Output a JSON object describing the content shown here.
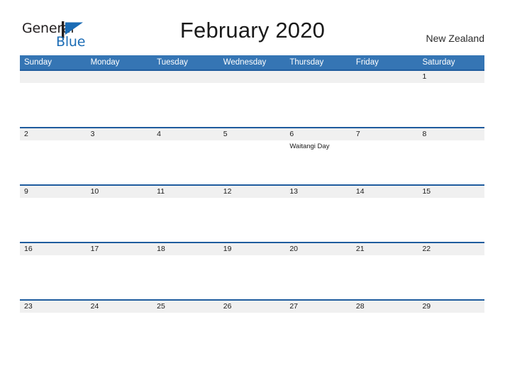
{
  "brand": {
    "word_one": "General",
    "word_two": "Blue",
    "mark": "triangle-flag-icon",
    "accent_color": "#1b6cb5"
  },
  "header": {
    "title": "February 2020",
    "region": "New Zealand"
  },
  "colors": {
    "header_blue": "#3575b4",
    "divider_blue": "#1f5c9e",
    "date_band_gray": "#f0f0f0",
    "text": "#1a1a1a"
  },
  "calendar": {
    "month": "February",
    "year": "2020",
    "weekday_headers": [
      "Sunday",
      "Monday",
      "Tuesday",
      "Wednesday",
      "Thursday",
      "Friday",
      "Saturday"
    ],
    "weeks": [
      {
        "days": [
          {
            "date": "",
            "event": ""
          },
          {
            "date": "",
            "event": ""
          },
          {
            "date": "",
            "event": ""
          },
          {
            "date": "",
            "event": ""
          },
          {
            "date": "",
            "event": ""
          },
          {
            "date": "",
            "event": ""
          },
          {
            "date": "1",
            "event": ""
          }
        ]
      },
      {
        "days": [
          {
            "date": "2",
            "event": ""
          },
          {
            "date": "3",
            "event": ""
          },
          {
            "date": "4",
            "event": ""
          },
          {
            "date": "5",
            "event": ""
          },
          {
            "date": "6",
            "event": "Waitangi Day"
          },
          {
            "date": "7",
            "event": ""
          },
          {
            "date": "8",
            "event": ""
          }
        ]
      },
      {
        "days": [
          {
            "date": "9",
            "event": ""
          },
          {
            "date": "10",
            "event": ""
          },
          {
            "date": "11",
            "event": ""
          },
          {
            "date": "12",
            "event": ""
          },
          {
            "date": "13",
            "event": ""
          },
          {
            "date": "14",
            "event": ""
          },
          {
            "date": "15",
            "event": ""
          }
        ]
      },
      {
        "days": [
          {
            "date": "16",
            "event": ""
          },
          {
            "date": "17",
            "event": ""
          },
          {
            "date": "18",
            "event": ""
          },
          {
            "date": "19",
            "event": ""
          },
          {
            "date": "20",
            "event": ""
          },
          {
            "date": "21",
            "event": ""
          },
          {
            "date": "22",
            "event": ""
          }
        ]
      },
      {
        "days": [
          {
            "date": "23",
            "event": ""
          },
          {
            "date": "24",
            "event": ""
          },
          {
            "date": "25",
            "event": ""
          },
          {
            "date": "26",
            "event": ""
          },
          {
            "date": "27",
            "event": ""
          },
          {
            "date": "28",
            "event": ""
          },
          {
            "date": "29",
            "event": ""
          }
        ]
      }
    ]
  }
}
